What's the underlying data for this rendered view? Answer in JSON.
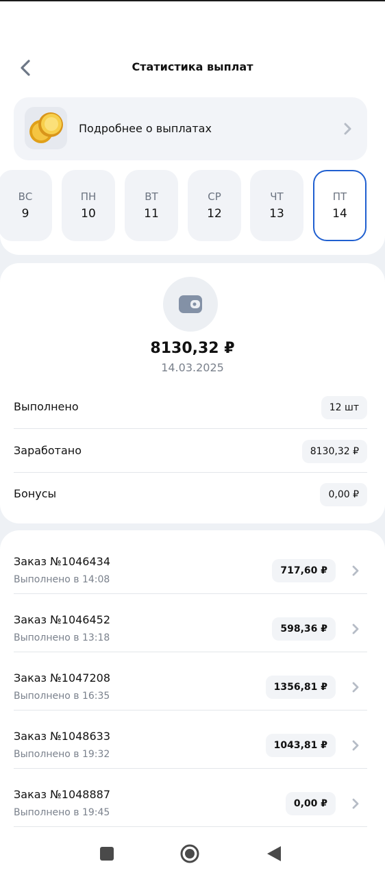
{
  "header": {
    "title": "Статистика выплат"
  },
  "info_card": {
    "label": "Подробнее о выплатах"
  },
  "days": [
    {
      "name": "ВС",
      "num": "9",
      "selected": false
    },
    {
      "name": "ПН",
      "num": "10",
      "selected": false
    },
    {
      "name": "ВТ",
      "num": "11",
      "selected": false
    },
    {
      "name": "СР",
      "num": "12",
      "selected": false
    },
    {
      "name": "ЧТ",
      "num": "13",
      "selected": false
    },
    {
      "name": "ПТ",
      "num": "14",
      "selected": true
    }
  ],
  "summary": {
    "total": "8130,32 ₽",
    "date": "14.03.2025",
    "stats": [
      {
        "label": "Выполнено",
        "value": "12 шт"
      },
      {
        "label": "Заработано",
        "value": "8130,32 ₽"
      },
      {
        "label": "Бонусы",
        "value": "0,00 ₽"
      }
    ]
  },
  "orders": [
    {
      "title": "Заказ №1046434",
      "subtitle": "Выполнено в 14:08",
      "amount": "717,60 ₽"
    },
    {
      "title": "Заказ №1046452",
      "subtitle": "Выполнено в 13:18",
      "amount": "598,36 ₽"
    },
    {
      "title": "Заказ №1047208",
      "subtitle": "Выполнено в 16:35",
      "amount": "1356,81 ₽"
    },
    {
      "title": "Заказ №1048633",
      "subtitle": "Выполнено в 19:32",
      "amount": "1043,81 ₽"
    },
    {
      "title": "Заказ №1048887",
      "subtitle": "Выполнено в 19:45",
      "amount": "0,00 ₽"
    }
  ],
  "icons": {
    "back": "chevron-left-icon",
    "coin": "coins-icon",
    "wallet": "wallet-icon",
    "chevron": "chevron-right-icon"
  },
  "colors": {
    "accent": "#1f5fd0",
    "muted_text": "#7a818c"
  }
}
